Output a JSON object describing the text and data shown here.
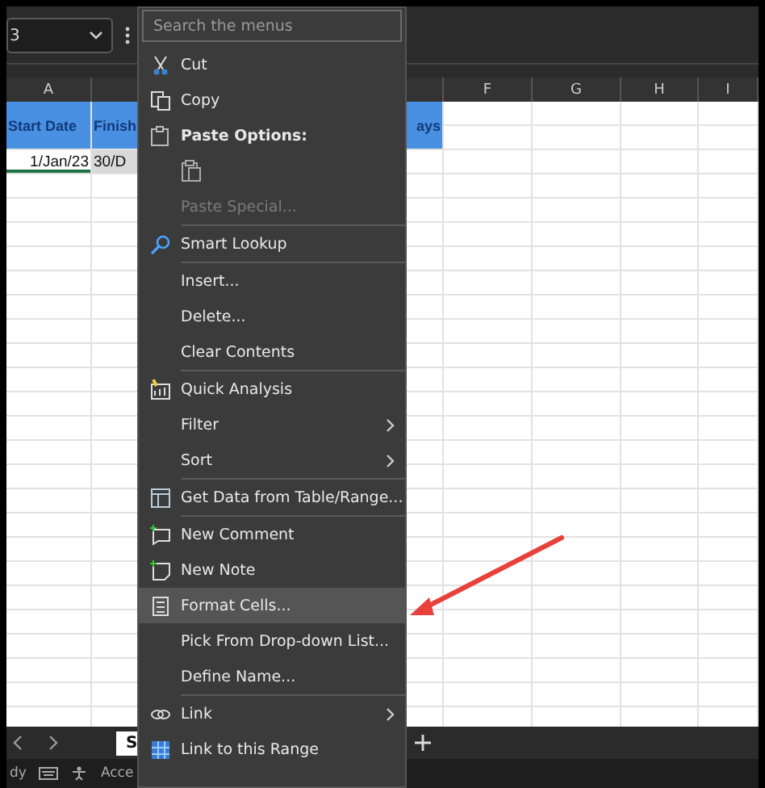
{
  "name_box": {
    "value": "3"
  },
  "column_headers_left": [
    "A"
  ],
  "column_headers_right": [
    "F",
    "G",
    "H",
    "I"
  ],
  "rows": [
    {
      "kind": "header",
      "cells_left": [
        {
          "text": "Start Date",
          "selected": false
        },
        {
          "text": "Finish",
          "selected": false
        }
      ],
      "cells_right": [
        {
          "text": "ays",
          "selected": false
        }
      ]
    },
    {
      "kind": "data",
      "cells_left": [
        {
          "text": "1/Jan/23",
          "selected": false
        },
        {
          "text": "30/D",
          "selected": true
        }
      ],
      "cells_right": []
    }
  ],
  "sheet_tabs": [
    {
      "label": "S",
      "selected": true
    }
  ],
  "status_bar": {
    "left": "dy",
    "accessibility": "Acce"
  },
  "context_menu": {
    "search": {
      "placeholder": "Search the menus"
    },
    "items": [
      {
        "kind": "item",
        "label": "Cut",
        "disabled": false,
        "selected": false,
        "submenu": false
      },
      {
        "kind": "item",
        "label": "Copy",
        "disabled": false,
        "selected": false,
        "submenu": false
      },
      {
        "kind": "heading",
        "label": "Paste Options:"
      },
      {
        "kind": "paste-option"
      },
      {
        "kind": "item",
        "label": "Paste Special...",
        "disabled": true,
        "selected": false,
        "submenu": false
      },
      {
        "kind": "separator"
      },
      {
        "kind": "item",
        "label": "Smart Lookup",
        "disabled": false,
        "selected": false,
        "submenu": false
      },
      {
        "kind": "separator"
      },
      {
        "kind": "item",
        "label": "Insert...",
        "disabled": false,
        "selected": false,
        "submenu": false
      },
      {
        "kind": "item",
        "label": "Delete...",
        "disabled": false,
        "selected": false,
        "submenu": false
      },
      {
        "kind": "item",
        "label": "Clear Contents",
        "disabled": false,
        "selected": false,
        "submenu": false
      },
      {
        "kind": "separator"
      },
      {
        "kind": "item",
        "label": "Quick Analysis",
        "disabled": false,
        "selected": false,
        "submenu": false
      },
      {
        "kind": "item",
        "label": "Filter",
        "disabled": false,
        "selected": false,
        "submenu": true
      },
      {
        "kind": "item",
        "label": "Sort",
        "disabled": false,
        "selected": false,
        "submenu": true
      },
      {
        "kind": "separator"
      },
      {
        "kind": "item",
        "label": "Get Data from Table/Range...",
        "disabled": false,
        "selected": false,
        "submenu": false
      },
      {
        "kind": "separator"
      },
      {
        "kind": "item",
        "label": "New Comment",
        "disabled": false,
        "selected": false,
        "submenu": false
      },
      {
        "kind": "item",
        "label": "New Note",
        "disabled": false,
        "selected": false,
        "submenu": false
      },
      {
        "kind": "item",
        "label": "Format Cells...",
        "disabled": false,
        "selected": true,
        "submenu": false
      },
      {
        "kind": "item",
        "label": "Pick From Drop-down List...",
        "disabled": false,
        "selected": false,
        "submenu": false
      },
      {
        "kind": "item",
        "label": "Define Name...",
        "disabled": false,
        "selected": false,
        "submenu": false
      },
      {
        "kind": "separator"
      },
      {
        "kind": "item",
        "label": "Link",
        "disabled": false,
        "selected": false,
        "submenu": true
      },
      {
        "kind": "item",
        "label": "Link to this Range",
        "disabled": false,
        "selected": false,
        "submenu": false
      }
    ]
  }
}
